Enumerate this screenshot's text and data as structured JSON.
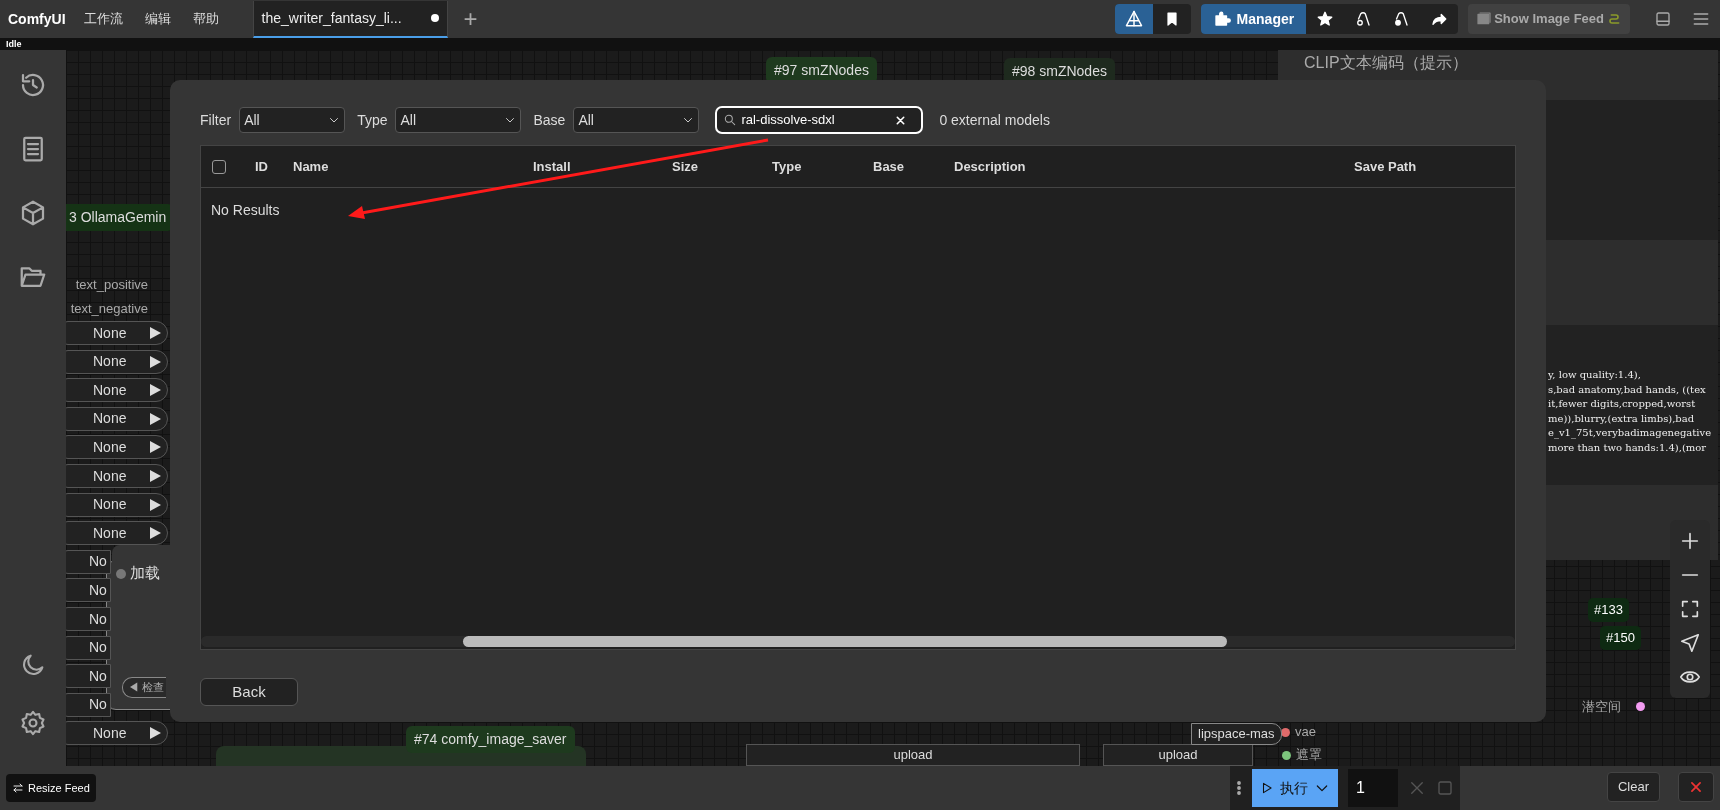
{
  "menu_bar": {
    "logo": "ComfyUI",
    "menus": [
      "工作流",
      "编辑",
      "帮助"
    ],
    "tabs": [
      {
        "label": "the_writer_fantasy_li...",
        "selected": true,
        "modified": true
      }
    ],
    "new_tab": "+",
    "manager_button": "Manager",
    "image_feed_button": "Show Image Feed"
  },
  "status": "Idle",
  "canvas": {
    "node_titles": [
      "#97 smZNodes",
      "#98 smZNodes",
      "CLIP文本编码（提示）",
      "3 OllamaGemin",
      "加载",
      "#74 comfy_image_saver"
    ],
    "input_labels": [
      "text_positive",
      "text_negative"
    ],
    "pills": [
      "None",
      "None",
      "None",
      "None",
      "None",
      "None",
      "None",
      "None",
      "No",
      "No",
      "No",
      "No",
      "No",
      "No",
      "None"
    ],
    "node_button": "◀ 检查",
    "prompt_lines": [
      "y, low quality:1.4),",
      "s,bad anatomy,bad hands, ((tex",
      "it,fewer digits,cropped,worst",
      "me)),blurry,(extra limbs),bad",
      "e_v1_75t,verybadimagenegative",
      "more than two hands:1.4),(mor"
    ],
    "badges": [
      "#133",
      "#150"
    ],
    "sockets": [
      {
        "label": "潜空间",
        "color": "#f49cf2"
      },
      {
        "label": "vae",
        "color": "#e06b6b"
      },
      {
        "label": "遮罩",
        "color": "#7cc47c"
      }
    ],
    "widget_label": "lipspace-mas",
    "upload_buttons": [
      "upload",
      "upload"
    ]
  },
  "dialog": {
    "filters": [
      {
        "label": "Filter",
        "value": "All"
      },
      {
        "label": "Type",
        "value": "All"
      },
      {
        "label": "Base",
        "value": "All"
      }
    ],
    "search": {
      "value": "ral-dissolve-sdxl"
    },
    "count": "0 external models",
    "table": {
      "select_all_checked": false,
      "columns": [
        "ID",
        "Name",
        "Install",
        "Size",
        "Type",
        "Base",
        "Description",
        "Save Path"
      ],
      "empty_text": "No Results"
    },
    "back_button": "Back"
  },
  "bottom_bar": {
    "resize_button": "Resize Feed",
    "run_button": "执行",
    "batch_count": "1",
    "clear_button": "Clear"
  }
}
